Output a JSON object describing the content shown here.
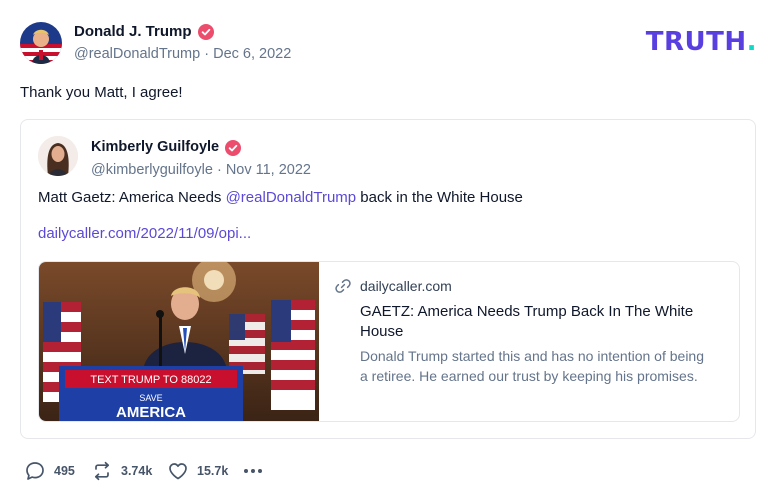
{
  "author": {
    "name": "Donald J. Trump",
    "handle": "@realDonaldTrump",
    "date_sep": "·",
    "date": "Dec 6, 2022"
  },
  "brand": {
    "text": "TRUTH",
    "dot": "."
  },
  "post": {
    "text": "Thank you Matt, I agree!"
  },
  "quote": {
    "name": "Kimberly Guilfoyle",
    "handle": "@kimberlyguilfoyle",
    "date_sep": "·",
    "date": "Nov 11, 2022",
    "text_before": "Matt Gaetz: America Needs ",
    "mention": "@realDonaldTrump",
    "text_after": " back in the White House",
    "link": "dailycaller.com/2022/11/09/opi...",
    "preview": {
      "domain": "dailycaller.com",
      "title": "GAETZ: America Needs Trump Back In The White House",
      "description": "Donald Trump started this and has no intention of being a retiree. He earned our trust by keeping his promises.",
      "image_sign_line1": "TEXT TRUMP TO 88022",
      "image_sign_line2": "SAVE",
      "image_sign_line3": "AMERICA"
    }
  },
  "actions": {
    "replies": "495",
    "retruths": "3.74k",
    "likes": "15.7k"
  },
  "colors": {
    "brand": "#5a3fe0",
    "brand_dot": "#10d9c5",
    "link": "#5b49d6",
    "verified": "#ec4d6d",
    "muted": "#64748b"
  },
  "icons": [
    "verified-badge-icon",
    "link-icon",
    "reply-icon",
    "retruth-icon",
    "like-icon",
    "more-icon"
  ]
}
